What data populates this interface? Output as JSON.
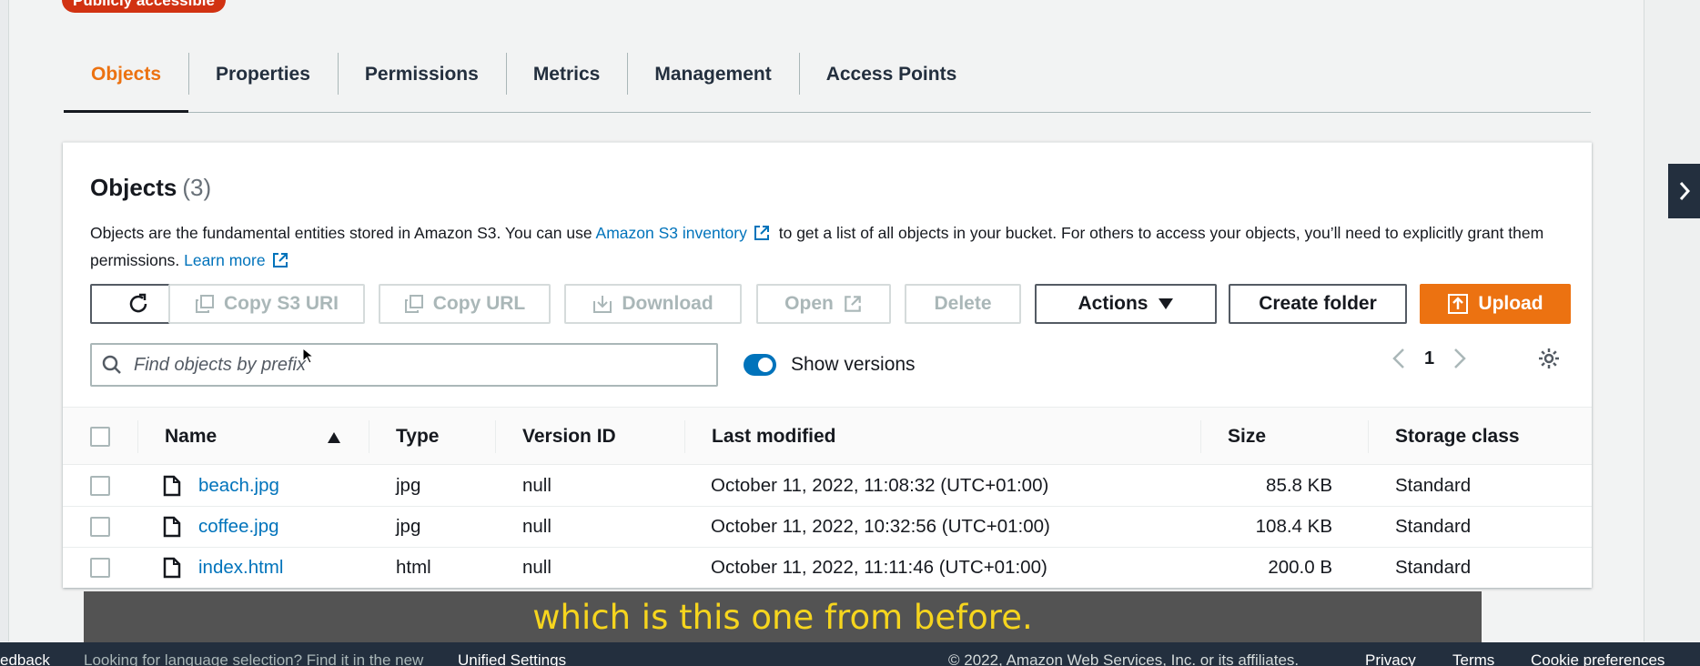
{
  "bucket": {
    "access_badge": "Publicly accessible"
  },
  "tabs": [
    {
      "label": "Objects",
      "active": true
    },
    {
      "label": "Properties"
    },
    {
      "label": "Permissions"
    },
    {
      "label": "Metrics"
    },
    {
      "label": "Management"
    },
    {
      "label": "Access Points"
    }
  ],
  "objects": {
    "title": "Objects",
    "count": "(3)",
    "desc_part1": "Objects are the fundamental entities stored in Amazon S3. You can use",
    "inventory_link": "Amazon S3 inventory",
    "desc_part2": "to get a list of all objects in your bucket. For others to access your objects, you’ll need to explicitly grant them permissions.",
    "learn_more": "Learn more"
  },
  "toolbar": {
    "copy_s3_uri": "Copy S3 URI",
    "copy_url": "Copy URL",
    "download": "Download",
    "open": "Open",
    "delete": "Delete",
    "actions": "Actions",
    "create_folder": "Create folder",
    "upload": "Upload"
  },
  "search": {
    "placeholder": "Find objects by prefix"
  },
  "show_versions": {
    "label": "Show versions",
    "enabled": true
  },
  "pagination": {
    "current_page": "1"
  },
  "table": {
    "columns": {
      "name": "Name",
      "type": "Type",
      "version_id": "Version ID",
      "last_modified": "Last modified",
      "size": "Size",
      "storage_class": "Storage class"
    },
    "rows": [
      {
        "name": "beach.jpg",
        "type": "jpg",
        "version_id": "null",
        "last_modified": "October 11, 2022, 11:08:32 (UTC+01:00)",
        "size": "85.8 KB",
        "storage_class": "Standard"
      },
      {
        "name": "coffee.jpg",
        "type": "jpg",
        "version_id": "null",
        "last_modified": "October 11, 2022, 10:32:56 (UTC+01:00)",
        "size": "108.4 KB",
        "storage_class": "Standard"
      },
      {
        "name": "index.html",
        "type": "html",
        "version_id": "null",
        "last_modified": "October 11, 2022, 11:11:46 (UTC+01:00)",
        "size": "200.0 B",
        "storage_class": "Standard"
      }
    ]
  },
  "caption": "which is this one from before.",
  "footer": {
    "feedback": "edback",
    "language_note": "Looking for language selection? Find it in the new",
    "unified_settings": "Unified Settings",
    "copyright": "© 2022, Amazon Web Services, Inc. or its affiliates.",
    "privacy": "Privacy",
    "terms": "Terms",
    "cookie_prefs": "Cookie preferences"
  },
  "colors": {
    "accent": "#ec7211",
    "link": "#0073bb",
    "danger": "#d13212",
    "footer_bg": "#232f3e"
  }
}
